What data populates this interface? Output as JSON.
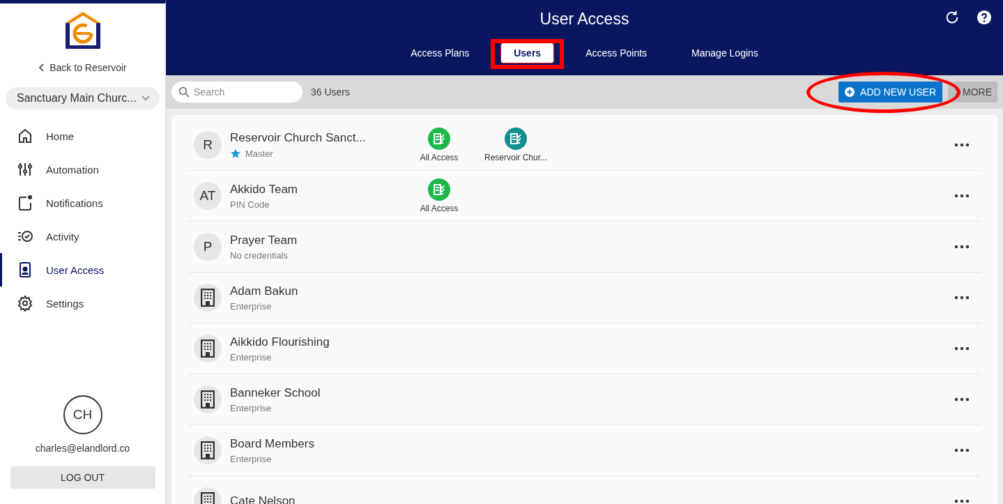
{
  "sidebar": {
    "back_link": "Back to Reservoir",
    "site_select": {
      "value": "Sanctuary Main Churc..."
    },
    "items": [
      {
        "label": "Home",
        "kind": "home",
        "selected": false
      },
      {
        "label": "Automation",
        "kind": "sliders",
        "selected": false
      },
      {
        "label": "Notifications",
        "kind": "bell",
        "selected": false
      },
      {
        "label": "Activity",
        "kind": "activity",
        "selected": false
      },
      {
        "label": "User Access",
        "kind": "badge",
        "selected": true
      },
      {
        "label": "Settings",
        "kind": "gear",
        "selected": false
      }
    ],
    "account": {
      "initials": "CH",
      "email": "charles@elandlord.co",
      "logout": "LOG OUT"
    }
  },
  "header": {
    "title": "User Access",
    "tabs": [
      {
        "label": "Access Plans",
        "selected": false,
        "highlighted": false
      },
      {
        "label": "Users",
        "selected": true,
        "highlighted": true
      },
      {
        "label": "Access Points",
        "selected": false,
        "highlighted": false
      },
      {
        "label": "Manage Logins",
        "selected": false,
        "highlighted": false
      }
    ]
  },
  "toolbar": {
    "search": {
      "placeholder": "Search"
    },
    "count": "36 Users",
    "add_button": {
      "label": "ADD NEW USER",
      "circled": true
    },
    "more_button": {
      "label": "MORE"
    }
  },
  "users": [
    {
      "name": "Reservoir Church Sanct...",
      "subtitle": "Master",
      "starred": true,
      "avatar": {
        "kind": "initials",
        "text": "R"
      },
      "plans": [
        {
          "label": "All Access",
          "color": "#1cb84a"
        },
        {
          "label": "Reservoir Chur...",
          "color": "#138f8f"
        }
      ]
    },
    {
      "name": "Akkido Team",
      "subtitle": "PIN Code",
      "starred": false,
      "avatar": {
        "kind": "initials",
        "text": "AT"
      },
      "plans": [
        {
          "label": "All Access",
          "color": "#1cb84a"
        }
      ]
    },
    {
      "name": "Prayer Team",
      "subtitle": "No credentials",
      "starred": false,
      "avatar": {
        "kind": "initials",
        "text": "P"
      }
    },
    {
      "name": "Adam Bakun",
      "subtitle": "Enterprise",
      "starred": false,
      "avatar": {
        "kind": "building"
      }
    },
    {
      "name": "Aikkido Flourishing",
      "subtitle": "Enterprise",
      "starred": false,
      "avatar": {
        "kind": "building"
      }
    },
    {
      "name": "Banneker School",
      "subtitle": "Enterprise",
      "starred": false,
      "avatar": {
        "kind": "building"
      }
    },
    {
      "name": "Board Members",
      "subtitle": "Enterprise",
      "starred": false,
      "avatar": {
        "kind": "building"
      }
    },
    {
      "name": "Cate Nelson",
      "starred": false,
      "avatar": {
        "kind": "building"
      }
    }
  ]
}
